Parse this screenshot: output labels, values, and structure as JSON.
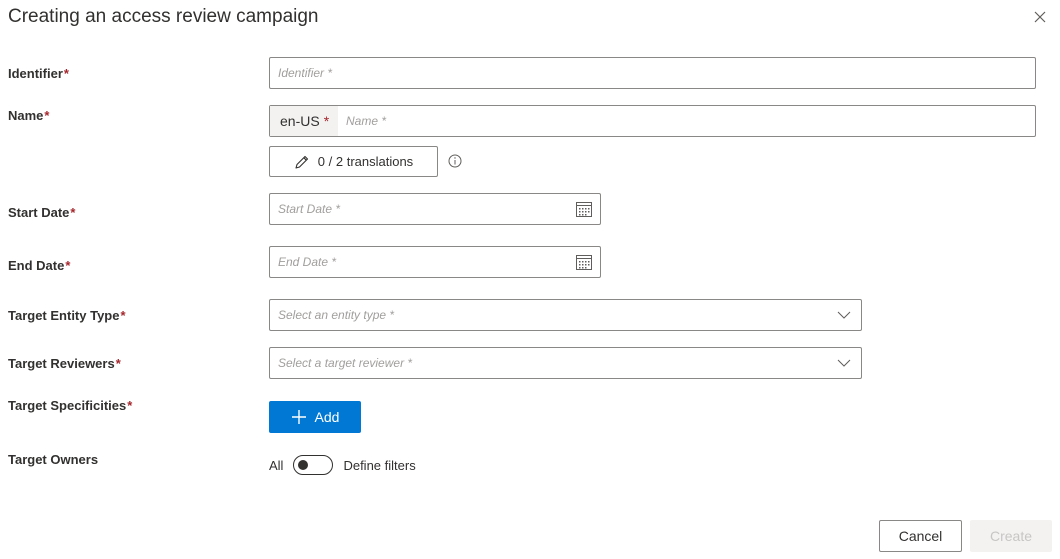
{
  "dialog": {
    "title": "Creating an access review campaign",
    "close_icon": "close-icon"
  },
  "fields": {
    "identifier": {
      "label": "Identifier",
      "required": "*",
      "placeholder": "Identifier *",
      "value": ""
    },
    "name": {
      "label": "Name",
      "required": "*",
      "locale": "en-US",
      "locale_required": "*",
      "placeholder": "Name *",
      "value": ""
    },
    "translations": {
      "label": "0 / 2 translations",
      "icon": "edit-pencil-icon",
      "info_icon": "info-icon"
    },
    "start_date": {
      "label": "Start Date",
      "required": "*",
      "placeholder": "Start Date *",
      "value": "",
      "icon": "calendar-icon"
    },
    "end_date": {
      "label": "End Date",
      "required": "*",
      "placeholder": "End Date *",
      "value": "",
      "icon": "calendar-icon"
    },
    "target_entity_type": {
      "label": "Target Entity Type",
      "required": "*",
      "placeholder": "Select an entity type *",
      "icon": "chevron-down-icon"
    },
    "target_reviewers": {
      "label": "Target Reviewers",
      "required": "*",
      "placeholder": "Select a target reviewer *",
      "icon": "chevron-down-icon"
    },
    "target_specificities": {
      "label": "Target Specificities",
      "required": "*",
      "add_label": "Add",
      "add_icon": "plus-icon"
    },
    "target_owners": {
      "label": "Target Owners",
      "toggle_off_label": "All",
      "toggle_on_label": "Define filters",
      "toggle_on": false
    }
  },
  "footer": {
    "cancel_label": "Cancel",
    "create_label": "Create",
    "create_enabled": false
  },
  "colors": {
    "primary": "#0078d4",
    "required": "#a4262c",
    "border": "#8a8886",
    "disabled_bg": "#f3f2f1",
    "disabled_text": "#c8c6c4"
  }
}
